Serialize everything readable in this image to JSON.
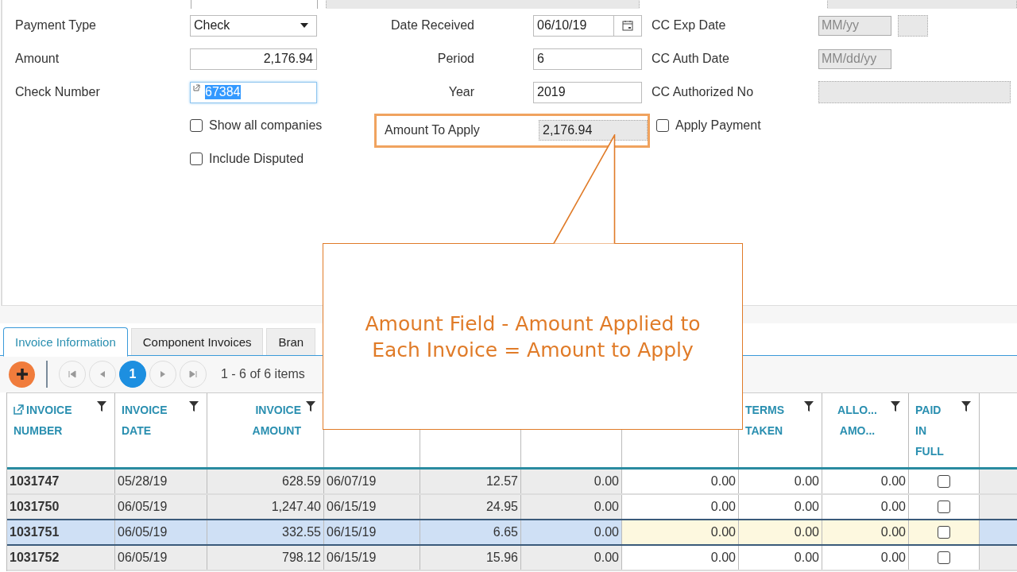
{
  "form": {
    "rows": [
      {
        "label": "Payment Type",
        "field": {
          "kind": "select",
          "value": "Check"
        },
        "label2": "Date Received",
        "field2": {
          "kind": "date",
          "value": "06/10/19"
        },
        "label3": "CC Exp Date",
        "field3": {
          "kind": "month",
          "placeholder": "MM/yy"
        }
      },
      {
        "label": "Amount",
        "field": {
          "kind": "number",
          "value": "2,176.94"
        },
        "label2": "Period",
        "field2": {
          "kind": "text",
          "value": "6"
        },
        "label3": "CC Auth Date",
        "field3": {
          "kind": "date",
          "placeholder": "MM/dd/yy"
        }
      },
      {
        "label": "Check Number",
        "field": {
          "kind": "link",
          "value": "67384",
          "selected": true
        },
        "label2": "Year",
        "field2": {
          "kind": "text",
          "value": "2019"
        },
        "label3": "CC Authorized No",
        "field3": {
          "kind": "disabled"
        }
      }
    ],
    "checkboxes": [
      {
        "label": "Show all companies",
        "checked": false
      },
      {
        "label": "Include Disputed",
        "checked": false
      }
    ],
    "amount_to_apply": {
      "label": "Amount To Apply",
      "value": "2,176.94"
    },
    "apply_payment": {
      "label": "Apply Payment",
      "checked": false
    }
  },
  "callout": {
    "text": "Amount Field - Amount Applied to Each Invoice = Amount to Apply"
  },
  "tabs": [
    {
      "label": "Invoice Information",
      "selected": true
    },
    {
      "label": "Component Invoices",
      "selected": false
    },
    {
      "label": "Bran",
      "selected": false
    }
  ],
  "pager": {
    "pages": [
      {
        "label": "1",
        "selected": true
      }
    ],
    "summary": "1 - 6 of 6 items"
  },
  "table": {
    "columns_left": [
      {
        "lines": [
          "INVOICE",
          "NUMBER"
        ]
      },
      {
        "lines": [
          "INVOICE",
          "DATE"
        ]
      },
      {
        "lines": [
          "INVOICE",
          "AMOUNT"
        ]
      }
    ],
    "columns_right": [
      {
        "lines": [
          "TERMS",
          "TAKEN"
        ]
      },
      {
        "lines": [
          "ALLO...",
          "AMO..."
        ]
      },
      {
        "lines": [
          "PAID",
          "IN",
          "FULL"
        ]
      }
    ],
    "rows": [
      {
        "selected": false,
        "cells": [
          "1031747",
          "05/28/19",
          "628.59",
          "06/07/19",
          "12.57",
          "0.00",
          "0.00",
          "0.00",
          "0.00"
        ],
        "paid": false
      },
      {
        "selected": false,
        "cells": [
          "1031750",
          "06/05/19",
          "1,247.40",
          "06/15/19",
          "24.95",
          "0.00",
          "0.00",
          "0.00",
          "0.00"
        ],
        "paid": false
      },
      {
        "selected": true,
        "cells": [
          "1031751",
          "06/05/19",
          "332.55",
          "06/15/19",
          "6.65",
          "0.00",
          "0.00",
          "0.00",
          "0.00"
        ],
        "paid": false
      },
      {
        "selected": false,
        "cells": [
          "1031752",
          "06/05/19",
          "798.12",
          "06/15/19",
          "15.96",
          "0.00",
          "0.00",
          "0.00",
          "0.00"
        ],
        "paid": false
      }
    ]
  }
}
